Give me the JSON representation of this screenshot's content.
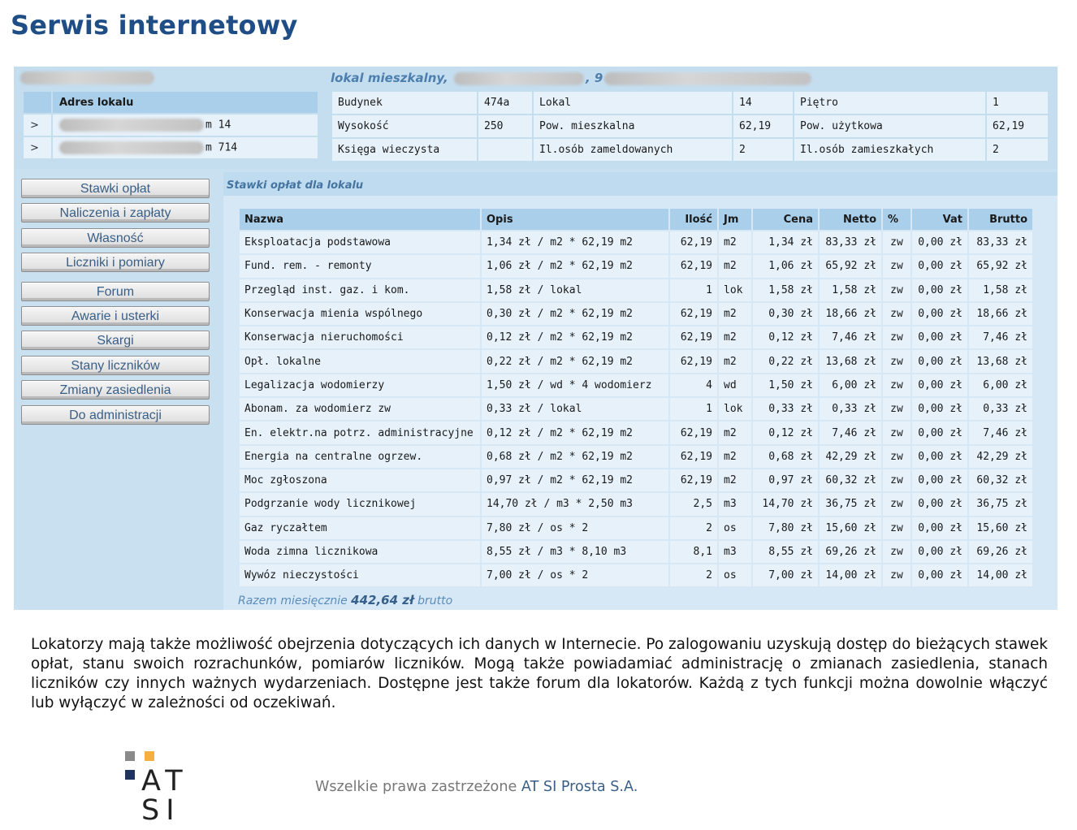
{
  "title": "Serwis internetowy",
  "flat": {
    "type_label": "lokal mieszkalny,",
    "sep1": ",",
    "sep2": "9"
  },
  "address": {
    "header": "Adres lokalu",
    "rows": [
      {
        "arrow": ">",
        "suffix": "m 14"
      },
      {
        "arrow": ">",
        "suffix": "m 714"
      }
    ]
  },
  "info": {
    "rows": [
      [
        {
          "label": "Budynek",
          "value": "474a"
        },
        {
          "label": "Lokal",
          "value": "14"
        },
        {
          "label": "Piętro",
          "value": "1"
        }
      ],
      [
        {
          "label": "Wysokość",
          "value": "250"
        },
        {
          "label": "Pow. mieszkalna",
          "value": "62,19"
        },
        {
          "label": "Pow. użytkowa",
          "value": "62,19"
        }
      ],
      [
        {
          "label": "Księga wieczysta",
          "value": ""
        },
        {
          "label": "Il.osób zameldowanych",
          "value": "2"
        },
        {
          "label": "Il.osób zamieszkałych",
          "value": "2"
        }
      ]
    ]
  },
  "menu": {
    "group1": [
      "Stawki opłat",
      "Naliczenia i zapłaty",
      "Własność",
      "Liczniki i pomiary"
    ],
    "group2": [
      "Forum",
      "Awarie i usterki",
      "Skargi",
      "Stany liczników",
      "Zmiany zasiedlenia",
      "Do administracji"
    ]
  },
  "rates": {
    "title": "Stawki opłat dla lokalu",
    "headers": [
      "Nazwa",
      "Opis",
      "Ilość",
      "Jm",
      "Cena",
      "Netto",
      "%",
      "Vat",
      "Brutto"
    ],
    "rows": [
      [
        "Eksploatacja podstawowa",
        "1,34 zł / m2 * 62,19 m2",
        "62,19",
        "m2",
        "1,34 zł",
        "83,33 zł",
        "zw",
        "0,00 zł",
        "83,33 zł"
      ],
      [
        "Fund. rem. - remonty",
        "1,06 zł / m2 * 62,19 m2",
        "62,19",
        "m2",
        "1,06 zł",
        "65,92 zł",
        "zw",
        "0,00 zł",
        "65,92 zł"
      ],
      [
        "Przegląd inst. gaz. i kom.",
        "1,58 zł / lokal",
        "1",
        "lok",
        "1,58 zł",
        "1,58 zł",
        "zw",
        "0,00 zł",
        "1,58 zł"
      ],
      [
        "Konserwacja mienia wspólnego",
        "0,30 zł / m2 * 62,19 m2",
        "62,19",
        "m2",
        "0,30 zł",
        "18,66 zł",
        "zw",
        "0,00 zł",
        "18,66 zł"
      ],
      [
        "Konserwacja nieruchomości",
        "0,12 zł / m2 * 62,19 m2",
        "62,19",
        "m2",
        "0,12 zł",
        "7,46 zł",
        "zw",
        "0,00 zł",
        "7,46 zł"
      ],
      [
        "Opł. lokalne",
        "0,22 zł / m2 * 62,19 m2",
        "62,19",
        "m2",
        "0,22 zł",
        "13,68 zł",
        "zw",
        "0,00 zł",
        "13,68 zł"
      ],
      [
        "Legalizacja wodomierzy",
        "1,50 zł / wd * 4 wodomierz",
        "4",
        "wd",
        "1,50 zł",
        "6,00 zł",
        "zw",
        "0,00 zł",
        "6,00 zł"
      ],
      [
        "Abonam. za wodomierz zw",
        "0,33 zł / lokal",
        "1",
        "lok",
        "0,33 zł",
        "0,33 zł",
        "zw",
        "0,00 zł",
        "0,33 zł"
      ],
      [
        "En. elektr.na potrz. administracyjne",
        "0,12 zł / m2 * 62,19 m2",
        "62,19",
        "m2",
        "0,12 zł",
        "7,46 zł",
        "zw",
        "0,00 zł",
        "7,46 zł"
      ],
      [
        "Energia na centralne ogrzew.",
        "0,68 zł / m2 * 62,19 m2",
        "62,19",
        "m2",
        "0,68 zł",
        "42,29 zł",
        "zw",
        "0,00 zł",
        "42,29 zł"
      ],
      [
        "Moc zgłoszona",
        "0,97 zł / m2 * 62,19 m2",
        "62,19",
        "m2",
        "0,97 zł",
        "60,32 zł",
        "zw",
        "0,00 zł",
        "60,32 zł"
      ],
      [
        "Podgrzanie wody licznikowej",
        "14,70 zł / m3 * 2,50 m3",
        "2,5",
        "m3",
        "14,70 zł",
        "36,75 zł",
        "zw",
        "0,00 zł",
        "36,75 zł"
      ],
      [
        "Gaz ryczałtem",
        "7,80 zł / os * 2",
        "2",
        "os",
        "7,80 zł",
        "15,60 zł",
        "zw",
        "0,00 zł",
        "15,60 zł"
      ],
      [
        "Woda zimna licznikowa",
        "8,55 zł / m3 * 8,10 m3",
        "8,1",
        "m3",
        "8,55 zł",
        "69,26 zł",
        "zw",
        "0,00 zł",
        "69,26 zł"
      ],
      [
        "Wywóz nieczystości",
        "7,00 zł / os * 2",
        "2",
        "os",
        "7,00 zł",
        "14,00 zł",
        "zw",
        "0,00 zł",
        "14,00 zł"
      ]
    ],
    "total_prefix": "Razem miesięcznie",
    "total_value": "442,64 zł",
    "total_suffix": "brutto"
  },
  "description": "Lokatorzy mają także możliwość obejrzenia dotyczących ich danych w Internecie. Po zalogowaniu uzyskują dostęp do bieżących stawek opłat, stanu swoich rozrachunków, pomiarów liczników. Mogą także powiadamiać administrację o zmianach zasiedlenia, stanach liczników czy innych ważnych wydarzeniach. Dostępne jest także forum dla lokatorów. Każdą z tych funkcji można dowolnie włączyć lub wyłączyć w zależności od oczekiwań.",
  "logo": {
    "line1": "AT",
    "line2": "SI"
  },
  "footer": {
    "rights": "Wszelkie prawa zastrzeżone",
    "company": "AT SI Prosta S.A."
  },
  "colors": {
    "title": "#1f4e86",
    "panel": "#c9e0f1",
    "header_cell": "#a9cfea",
    "cell": "#e6f1fa",
    "logo_orange": "#f5b041",
    "logo_gray": "#8a8a8a",
    "logo_navy": "#1f3560"
  }
}
